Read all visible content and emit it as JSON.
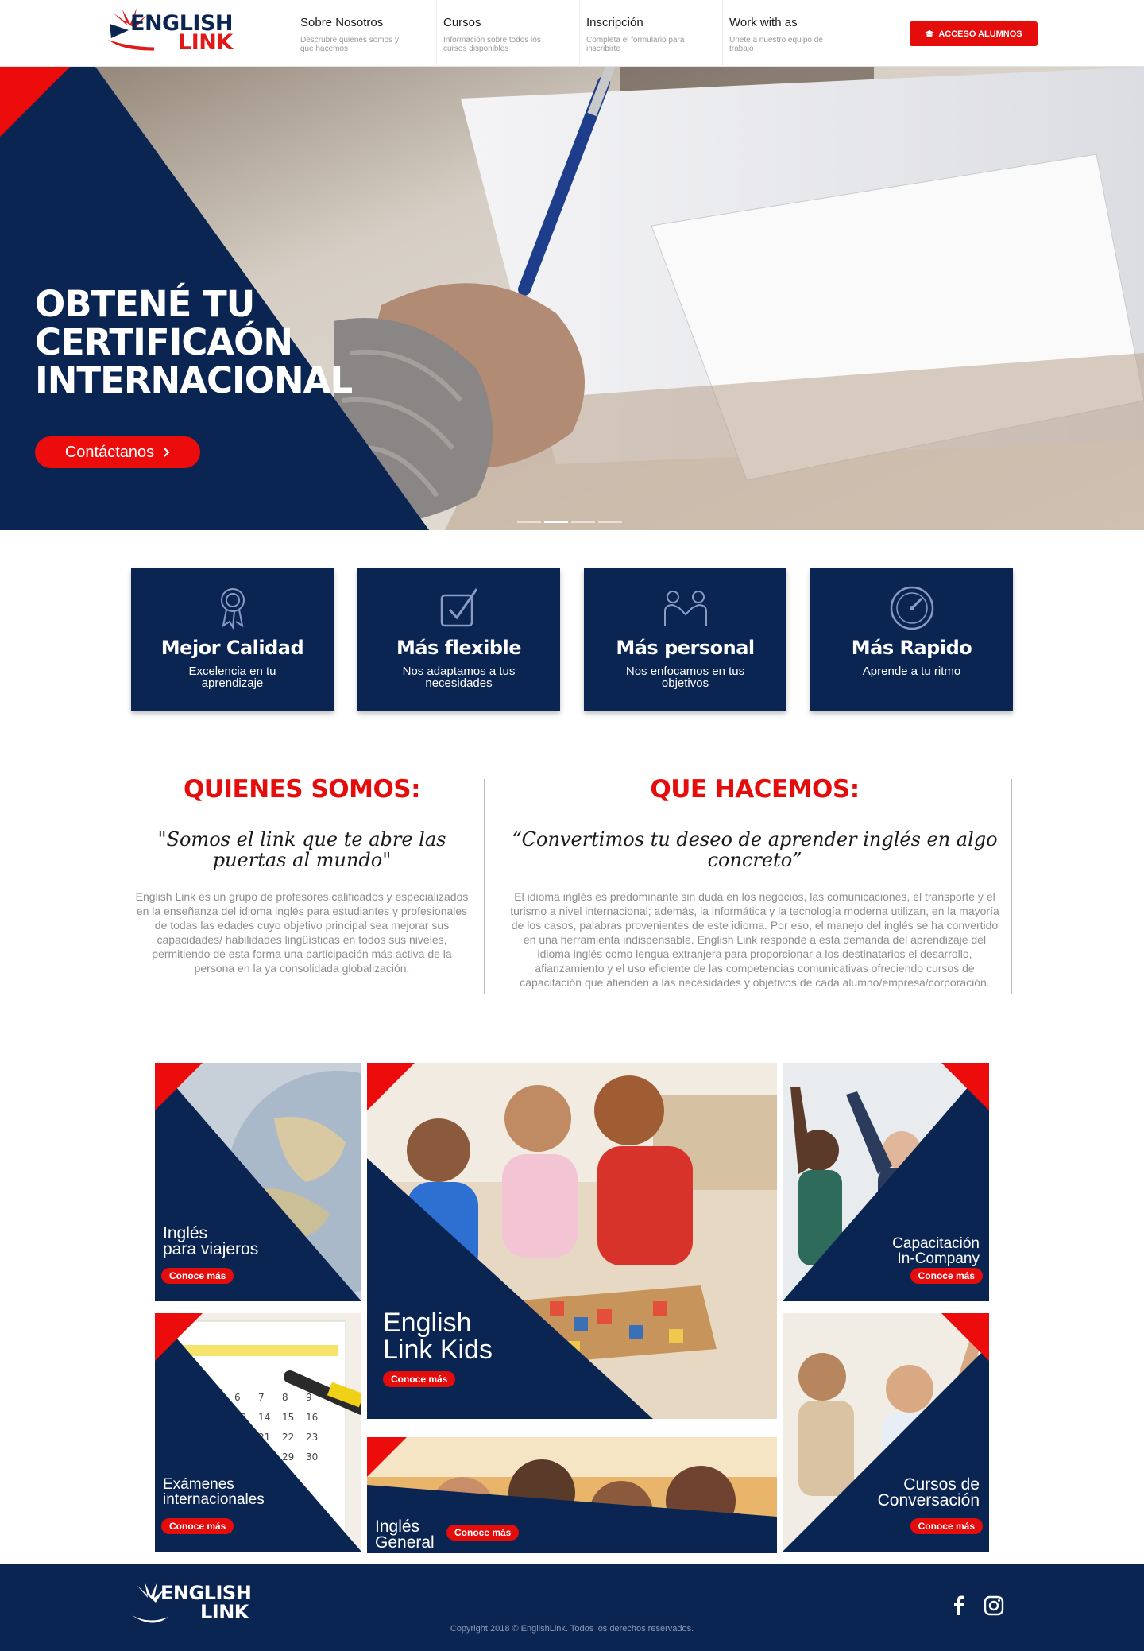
{
  "header": {
    "logo_line1": "ENGLISH",
    "logo_line2": "LINK",
    "nav": [
      {
        "title": "Sobre Nosotros",
        "desc": "Descrubre quienes somos y que hacemos"
      },
      {
        "title": "Cursos",
        "desc": "Información sobre todos los cursos disponibles"
      },
      {
        "title": "Inscripción",
        "desc": "Completa el formulario para inscribirte"
      },
      {
        "title": "Work with as",
        "desc": "Unete a nuestro equipo de trabajo"
      }
    ],
    "acceso_label": "ACCESO ALUMNOS",
    "acceso_icon": "graduation-cap-icon"
  },
  "hero": {
    "title_lines": [
      "OBTENÉ TU",
      "CERTIFICAÓN",
      "INTERNACIONAL"
    ],
    "cta_label": "Contáctanos",
    "slide_count": 4,
    "active_slide": 2
  },
  "features": [
    {
      "icon": "award-ribbon-icon",
      "title": "Mejor Calidad",
      "desc": "Excelencia en tu aprendizaje"
    },
    {
      "icon": "checkbox-icon",
      "title": "Más flexible",
      "desc": "Nos adaptamos a tus necesidades"
    },
    {
      "icon": "handshake-icon",
      "title": "Más personal",
      "desc": "Nos enfocamos en tus objetivos"
    },
    {
      "icon": "speedometer-icon",
      "title": "Más Rapido",
      "desc": "Aprende a tu ritmo"
    }
  ],
  "about": {
    "left": {
      "heading": "QUIENES SOMOS:",
      "quote": "\"Somos el link que te abre las puertas al mundo\"",
      "text": "English Link es un grupo de profesores calificados y especializados en la enseñanza del idioma inglés para estudiantes y profesionales de todas las edades cuyo objetivo principal sea mejorar sus capacidades/ habilidades lingüísticas en todos sus niveles, permitiendo de esta forma una participación más activa de la persona en la ya consolidada globalización."
    },
    "right": {
      "heading": "QUE HACEMOS:",
      "quote": "“Convertimos tu deseo de aprender inglés en algo concreto”",
      "text": "El idioma inglés es predominante sin duda en los negocios, las comunicaciones, el transporte y el turismo a nivel internacional; además, la informática y la tecnología moderna utilizan, en la mayoría de los casos, palabras provenientes de este idioma. Por eso, el manejo del inglés se ha convertido en una herramienta indispensable. English Link responde a esta demanda del aprendizaje del idioma inglés como lengua extranjera para proporcionar a los destinatarios el desarrollo, afianzamiento y el uso eficiente de las competencias comunicativas ofreciendo cursos de capacitación que atienden a las necesidades y objetivos de cada alumno/empresa/corporación."
    }
  },
  "tiles": {
    "viajeros": {
      "label1": "Inglés",
      "label2": "para viajeros",
      "cta": "Conoce más"
    },
    "kids": {
      "label1": "English",
      "label2": "Link Kids",
      "cta": "Conoce más"
    },
    "incompany": {
      "label1": "Capacitación",
      "label2": "In-Company",
      "cta": "Conoce más"
    },
    "examenes": {
      "label1": "Exámenes",
      "label2": "internacionales",
      "cta": "Conoce más"
    },
    "general": {
      "label1": "Inglés",
      "label2": "General",
      "cta": "Conoce más"
    },
    "conversacion": {
      "label1": "Cursos de",
      "label2": "Conversación",
      "cta": "Conoce más"
    }
  },
  "footer": {
    "logo_line1": "ENGLISH",
    "logo_line2": "LINK",
    "social": [
      "facebook-icon",
      "instagram-icon"
    ],
    "copyright": "Copyright 2018 © EnglishLink. Todos los derechos reservados."
  },
  "colors": {
    "navy": "#0b2553",
    "red": "#e50c0c",
    "white": "#ffffff"
  }
}
